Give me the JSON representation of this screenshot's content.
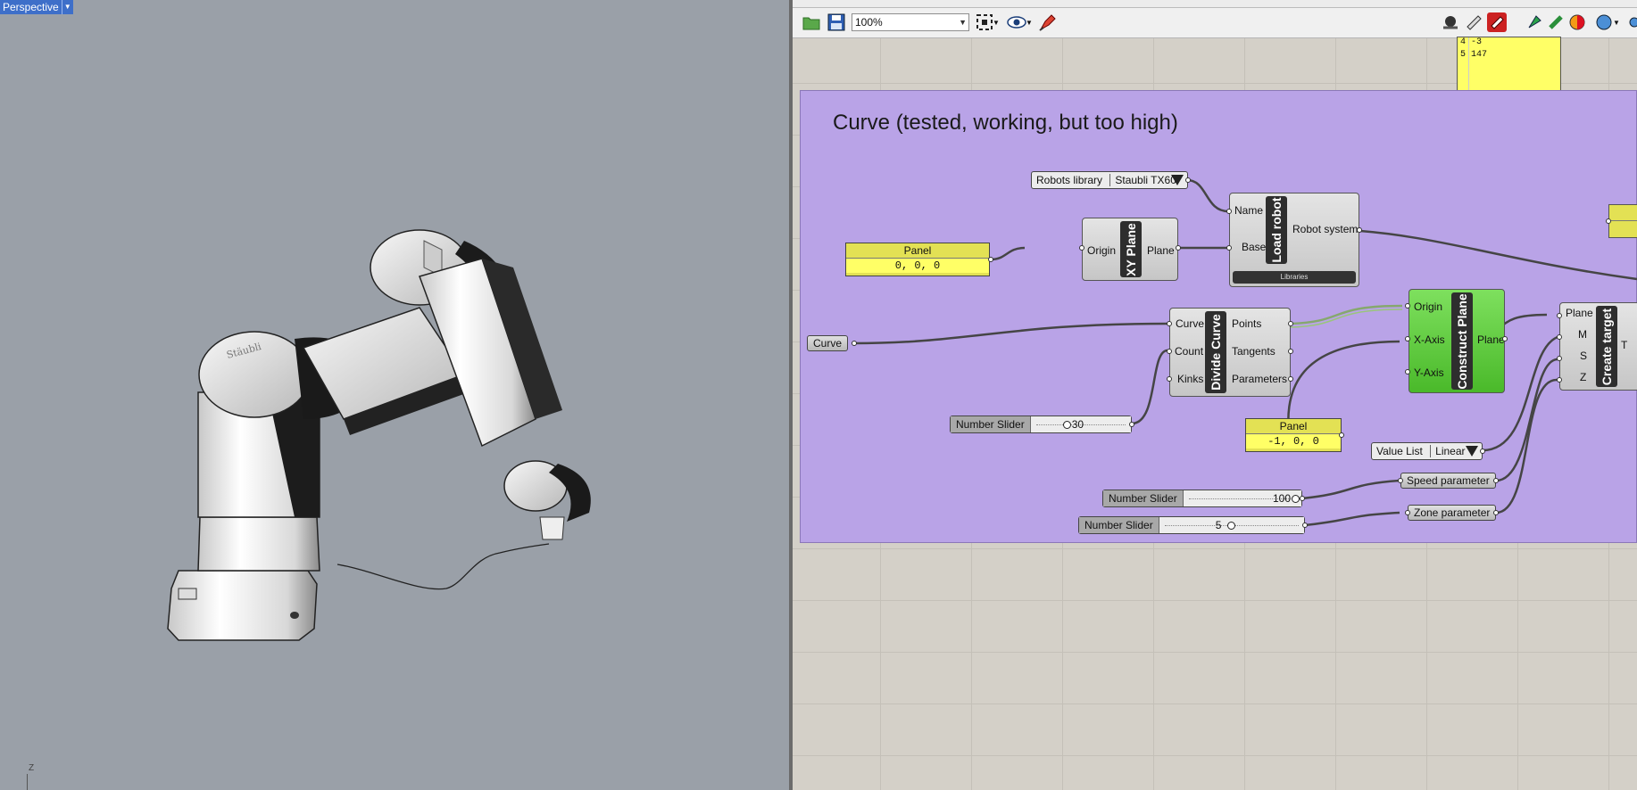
{
  "viewport": {
    "label": "Perspective",
    "axis_label": "Z"
  },
  "toolbar": {
    "zoom": "100%",
    "open_icon": "folder-open-icon",
    "save_icon": "save-icon",
    "zoom_extents_icon": "zoom-extents-icon",
    "preview_icon": "eye-icon",
    "sketch_icon": "pen-icon"
  },
  "top_panel": {
    "lines": [
      "4 -3",
      "5 147"
    ]
  },
  "group": {
    "title": "Curve (tested, working, but too high)"
  },
  "components": {
    "robots_library": {
      "left": "Robots library",
      "right": "Staubli TX60"
    },
    "load_robot": {
      "title": "Load robot",
      "in1": "Name",
      "in2": "Base",
      "out": "Robot system",
      "footer": "Libraries"
    },
    "panel_origin": {
      "header": "Panel",
      "value": "0, 0, 0"
    },
    "xy_plane": {
      "title": "XY Plane",
      "in": "Origin",
      "out": "Plane"
    },
    "curve_param": {
      "label": "Curve"
    },
    "divide_curve": {
      "title": "Divide Curve",
      "in1": "Curve",
      "in2": "Count",
      "in3": "Kinks",
      "out1": "Points",
      "out2": "Tangents",
      "out3": "Parameters"
    },
    "construct_plane": {
      "title": "Construct Plane",
      "in1": "Origin",
      "in2": "X-Axis",
      "in3": "Y-Axis",
      "out": "Plane"
    },
    "create_target": {
      "title": "Create target",
      "in1": "Plane",
      "in2": "M",
      "in3": "S",
      "in4": "Z",
      "out": "T"
    },
    "slider_count": {
      "name": "Number Slider",
      "value": "30"
    },
    "panel_xaxis": {
      "header": "Panel",
      "value": "-1, 0, 0"
    },
    "value_list": {
      "left": "Value List",
      "right": "Linear"
    },
    "slider_speed": {
      "name": "Number Slider",
      "value": "100"
    },
    "slider_zone": {
      "name": "Number Slider",
      "value": "5"
    },
    "speed_parameter": {
      "label": "Speed parameter"
    },
    "zone_parameter": {
      "label": "Zone parameter"
    }
  }
}
